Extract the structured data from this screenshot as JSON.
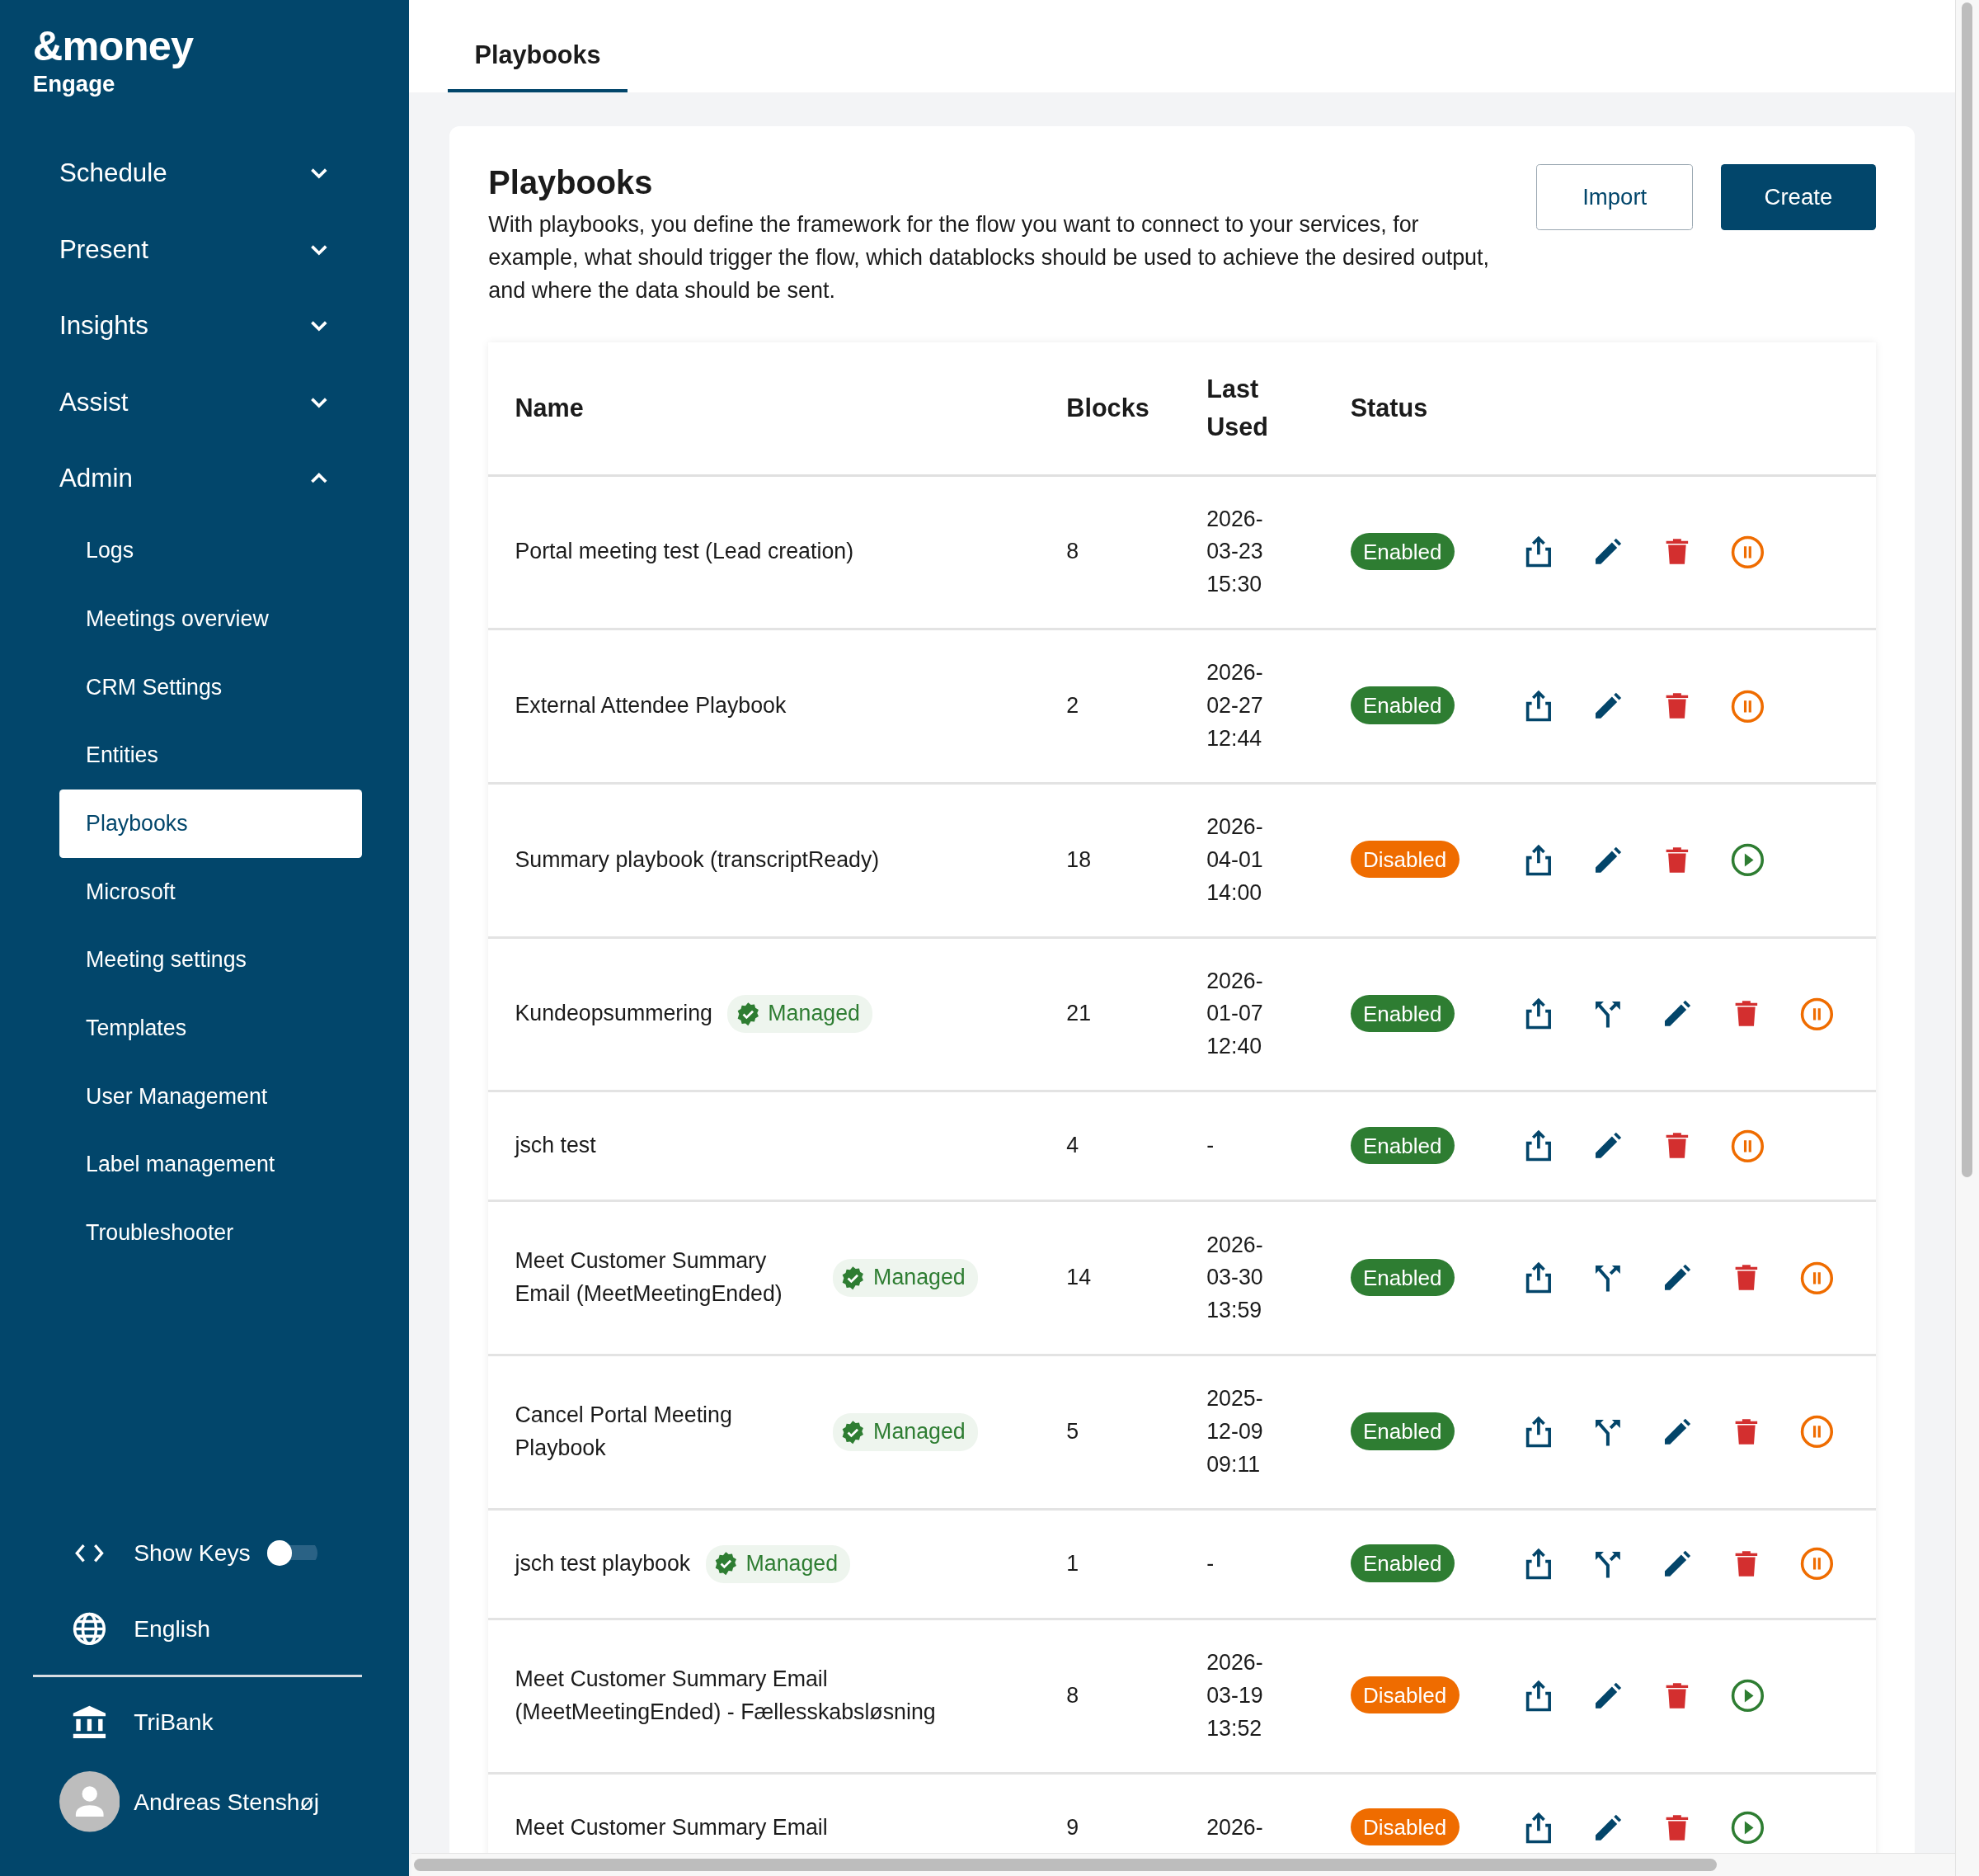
{
  "sidebar": {
    "logo": "&money",
    "product": "Engage",
    "sections": [
      {
        "label": "Schedule",
        "expanded": false
      },
      {
        "label": "Present",
        "expanded": false
      },
      {
        "label": "Insights",
        "expanded": false
      },
      {
        "label": "Assist",
        "expanded": false
      },
      {
        "label": "Admin",
        "expanded": true,
        "children": [
          {
            "label": "Logs",
            "selected": false
          },
          {
            "label": "Meetings overview",
            "selected": false
          },
          {
            "label": "CRM Settings",
            "selected": false
          },
          {
            "label": "Entities",
            "selected": false
          },
          {
            "label": "Playbooks",
            "selected": true
          },
          {
            "label": "Microsoft",
            "selected": false
          },
          {
            "label": "Meeting settings",
            "selected": false
          },
          {
            "label": "Templates",
            "selected": false
          },
          {
            "label": "User Management",
            "selected": false
          },
          {
            "label": "Label management",
            "selected": false
          },
          {
            "label": "Troubleshooter",
            "selected": false
          }
        ]
      }
    ],
    "show_keys": {
      "label": "Show Keys",
      "on": false
    },
    "language": "English",
    "organization": "TriBank",
    "user": "Andreas Stenshøj"
  },
  "tabs": [
    {
      "label": "Playbooks",
      "selected": true
    }
  ],
  "page": {
    "title": "Playbooks",
    "description": "With playbooks, you define the framework for the flow you want to connect to your services, for example, what should trigger the flow, which datablocks should be used to achieve the desired output, and where the data should be sent.",
    "buttons": [
      {
        "label": "Import",
        "kind": "secondary"
      },
      {
        "label": "Create",
        "kind": "primary"
      }
    ]
  },
  "table": {
    "columns": [
      "Name",
      "Blocks",
      "Last Used",
      "Status"
    ],
    "rows": [
      {
        "name": "Portal meeting test (Lead creation)",
        "blocks": "8",
        "last_used": "2026-03-23 15:30",
        "status": {
          "label": "Enabled",
          "kind": "enabled"
        },
        "actions": [
          {
            "kind": "export"
          },
          {
            "kind": "edit"
          },
          {
            "kind": "delete"
          },
          {
            "kind": "pause"
          }
        ]
      },
      {
        "name": "External Attendee Playbook",
        "blocks": "2",
        "last_used": "2026-02-27 12:44",
        "status": {
          "label": "Enabled",
          "kind": "enabled"
        },
        "actions": [
          {
            "kind": "export"
          },
          {
            "kind": "edit"
          },
          {
            "kind": "delete"
          },
          {
            "kind": "pause"
          }
        ]
      },
      {
        "name": "Summary playbook (transcriptReady)",
        "blocks": "18",
        "last_used": "2026-04-01 14:00",
        "status": {
          "label": "Disabled",
          "kind": "disabled"
        },
        "actions": [
          {
            "kind": "export"
          },
          {
            "kind": "edit"
          },
          {
            "kind": "delete"
          },
          {
            "kind": "play"
          }
        ]
      },
      {
        "name": "Kundeopsummering",
        "badge": "Managed",
        "blocks": "21",
        "last_used": "2026-01-07 12:40",
        "status": {
          "label": "Enabled",
          "kind": "enabled"
        },
        "actions": [
          {
            "kind": "export"
          },
          {
            "kind": "branch"
          },
          {
            "kind": "edit"
          },
          {
            "kind": "delete"
          },
          {
            "kind": "pause"
          }
        ]
      },
      {
        "name": "jsch test",
        "blocks": "4",
        "last_used": "-",
        "status": {
          "label": "Enabled",
          "kind": "enabled"
        },
        "actions": [
          {
            "kind": "export"
          },
          {
            "kind": "edit"
          },
          {
            "kind": "delete"
          },
          {
            "kind": "pause"
          }
        ]
      },
      {
        "name": "Meet Customer Summary Email (MeetMeetingEnded)",
        "badge": "Managed",
        "blocks": "14",
        "last_used": "2026-03-30 13:59",
        "status": {
          "label": "Enabled",
          "kind": "enabled"
        },
        "actions": [
          {
            "kind": "export"
          },
          {
            "kind": "branch"
          },
          {
            "kind": "edit"
          },
          {
            "kind": "delete"
          },
          {
            "kind": "pause"
          }
        ]
      },
      {
        "name": "Cancel Portal Meeting Playbook",
        "badge": "Managed",
        "blocks": "5",
        "last_used": "2025-12-09 09:11",
        "status": {
          "label": "Enabled",
          "kind": "enabled"
        },
        "actions": [
          {
            "kind": "export"
          },
          {
            "kind": "branch"
          },
          {
            "kind": "edit"
          },
          {
            "kind": "delete"
          },
          {
            "kind": "pause"
          }
        ]
      },
      {
        "name": "jsch test playbook",
        "badge": "Managed",
        "blocks": "1",
        "last_used": "-",
        "status": {
          "label": "Enabled",
          "kind": "enabled"
        },
        "actions": [
          {
            "kind": "export"
          },
          {
            "kind": "branch"
          },
          {
            "kind": "edit"
          },
          {
            "kind": "delete"
          },
          {
            "kind": "pause"
          }
        ]
      },
      {
        "name": "Meet Customer Summary Email (MeetMeetingEnded) - Fællesskabsløsning",
        "blocks": "8",
        "last_used": "2026-03-19 13:52",
        "status": {
          "label": "Disabled",
          "kind": "disabled"
        },
        "actions": [
          {
            "kind": "export"
          },
          {
            "kind": "edit"
          },
          {
            "kind": "delete"
          },
          {
            "kind": "play"
          }
        ]
      },
      {
        "name": "Meet Customer Summary Email",
        "blocks": "9",
        "last_used": "2026-",
        "status": {
          "label": "Disabled",
          "kind": "disabled"
        },
        "actions": [
          {
            "kind": "export"
          },
          {
            "kind": "edit"
          },
          {
            "kind": "delete"
          },
          {
            "kind": "play"
          }
        ]
      }
    ]
  }
}
